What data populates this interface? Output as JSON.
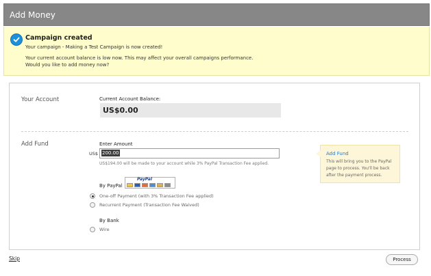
{
  "header": {
    "title": "Add Money"
  },
  "notice": {
    "icon": "check-circle-icon",
    "title": "Campaign created",
    "line1": "Your campaign - Making a Test Campaign is now created!",
    "line2": "Your current account balance is low now. This may affect your overall campaigns performance.",
    "line3": "Would you like to add money now?"
  },
  "account": {
    "section_label": "Your Account",
    "balance_label": "Current Account Balance:",
    "balance_value": "US$0.00"
  },
  "fund": {
    "section_label": "Add Fund",
    "amount_label": "Enter Amount",
    "currency": "US$",
    "amount_value": "200.00",
    "hint": "US$194.00 will be made to your account while 3% PayPal Transaction Fee applied.",
    "paypal_label": "By PayPal",
    "paypal_logo_text": "PayPal",
    "paypal_options": [
      {
        "label": "One-off Payment (with 3% Transaction Fee applied)",
        "selected": true
      },
      {
        "label": "Recurrent Payment (Transaction Fee Waived)",
        "selected": false
      }
    ],
    "bank_label": "By Bank",
    "bank_options": [
      {
        "label": "Wire",
        "selected": false
      }
    ]
  },
  "tip": {
    "title": "Add Fund",
    "line1": "This will bring you to the PayPal",
    "line2": "page to process. You'll be back",
    "line3": "after the payment process."
  },
  "footer": {
    "skip_label": "Skip",
    "process_label": "Process"
  },
  "colors": {
    "header_bg": "#878787",
    "notice_bg": "#fefdcb",
    "tip_bg": "#fdf6d8",
    "link": "#2f7ab7",
    "check_icon": "#1f8fd8"
  }
}
